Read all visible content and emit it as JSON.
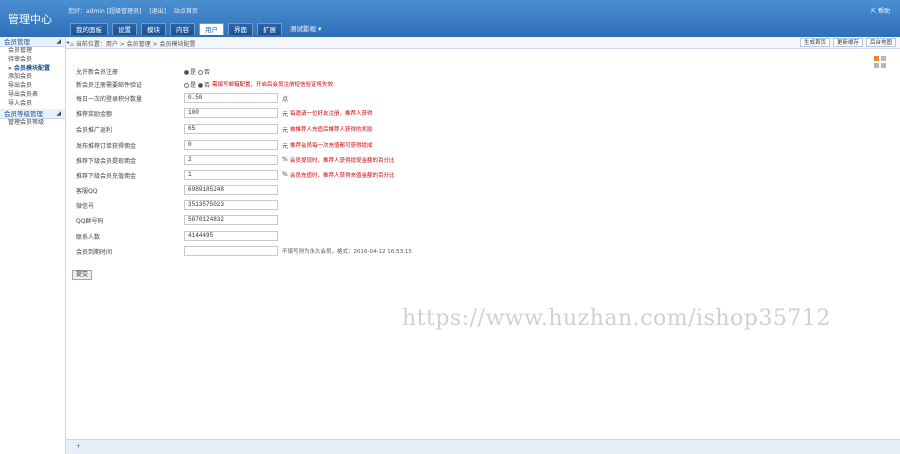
{
  "app": {
    "title": "管理中心"
  },
  "userbar": {
    "greeting": "您好：admin [超级管理员]",
    "logout": "[退出]",
    "site": "站点首页",
    "help": "帮助"
  },
  "nav": {
    "tabs": [
      "我的面板",
      "设置",
      "模块",
      "内容",
      "用户",
      "界面",
      "扩展"
    ],
    "active_index": 4,
    "more": "测试影视 ▾"
  },
  "sidebar": {
    "groups": [
      {
        "title": "会员管理",
        "items": [
          "会员管理",
          "待审会员",
          "会员模块配置",
          "添加会员",
          "导出会员",
          "导出会员表",
          "导入会员"
        ],
        "current_index": 2
      },
      {
        "title": "会员等级管理",
        "items": [
          "管理会员等级"
        ]
      }
    ]
  },
  "breadcrumb": {
    "text": "当前位置：用户 > 会员管理 > 会员模块配置"
  },
  "quick": [
    "生成首页",
    "更新缓存",
    "后台地图"
  ],
  "form": {
    "rows": [
      {
        "label": "允许新会员注册",
        "type": "radio",
        "options": [
          "是",
          "否"
        ],
        "selected": 0
      },
      {
        "label": "新会员注册需要邮件验证",
        "type": "radio",
        "options": [
          "是",
          "否"
        ],
        "selected": 1,
        "note": "需填写邮箱配置，开启后会员注册短信验证将失效"
      },
      {
        "label": "每日一次的登录积分数量",
        "type": "input",
        "value": "0.50",
        "unit": "点"
      },
      {
        "label": "推荐奖励金额",
        "type": "input",
        "value": "100",
        "unit": "元",
        "note": "每邀请一位好友注册，推荐人获得"
      },
      {
        "label": "会员推广返利",
        "type": "input",
        "value": "65",
        "unit": "元",
        "note": "被推荐人充值后推荐人获得的奖励"
      },
      {
        "label": "发布推荐订单获得佣金",
        "type": "input",
        "value": "0",
        "unit": "元",
        "note": "推荐会员每一次充值都可获得提成"
      },
      {
        "label": "推荐下级会员提现佣金",
        "type": "input",
        "value": "2",
        "unit": "%",
        "note": "会员提现时，推荐人获得提现金额的百分比"
      },
      {
        "label": "推荐下级会员充值佣金",
        "type": "input",
        "value": "1",
        "unit": "%",
        "note": "会员充值时，推荐人获得充值金额的百分比"
      },
      {
        "label": "客服QQ",
        "type": "input",
        "value": "6989185248"
      },
      {
        "label": "微信号",
        "type": "input",
        "value": "3513575023"
      },
      {
        "label": "QQ群号码",
        "type": "input",
        "value": "5870124832"
      },
      {
        "label": "联系人数",
        "type": "input",
        "value": "4144495"
      },
      {
        "label": "会员到期时间",
        "type": "input",
        "value": "",
        "note": "不填写则为永久会员，格式：2016-04-12 16:53:15"
      }
    ],
    "submit": "提交"
  },
  "watermark": "https://www.huzhan.com/ishop35712",
  "footer": {
    "text": "+"
  }
}
